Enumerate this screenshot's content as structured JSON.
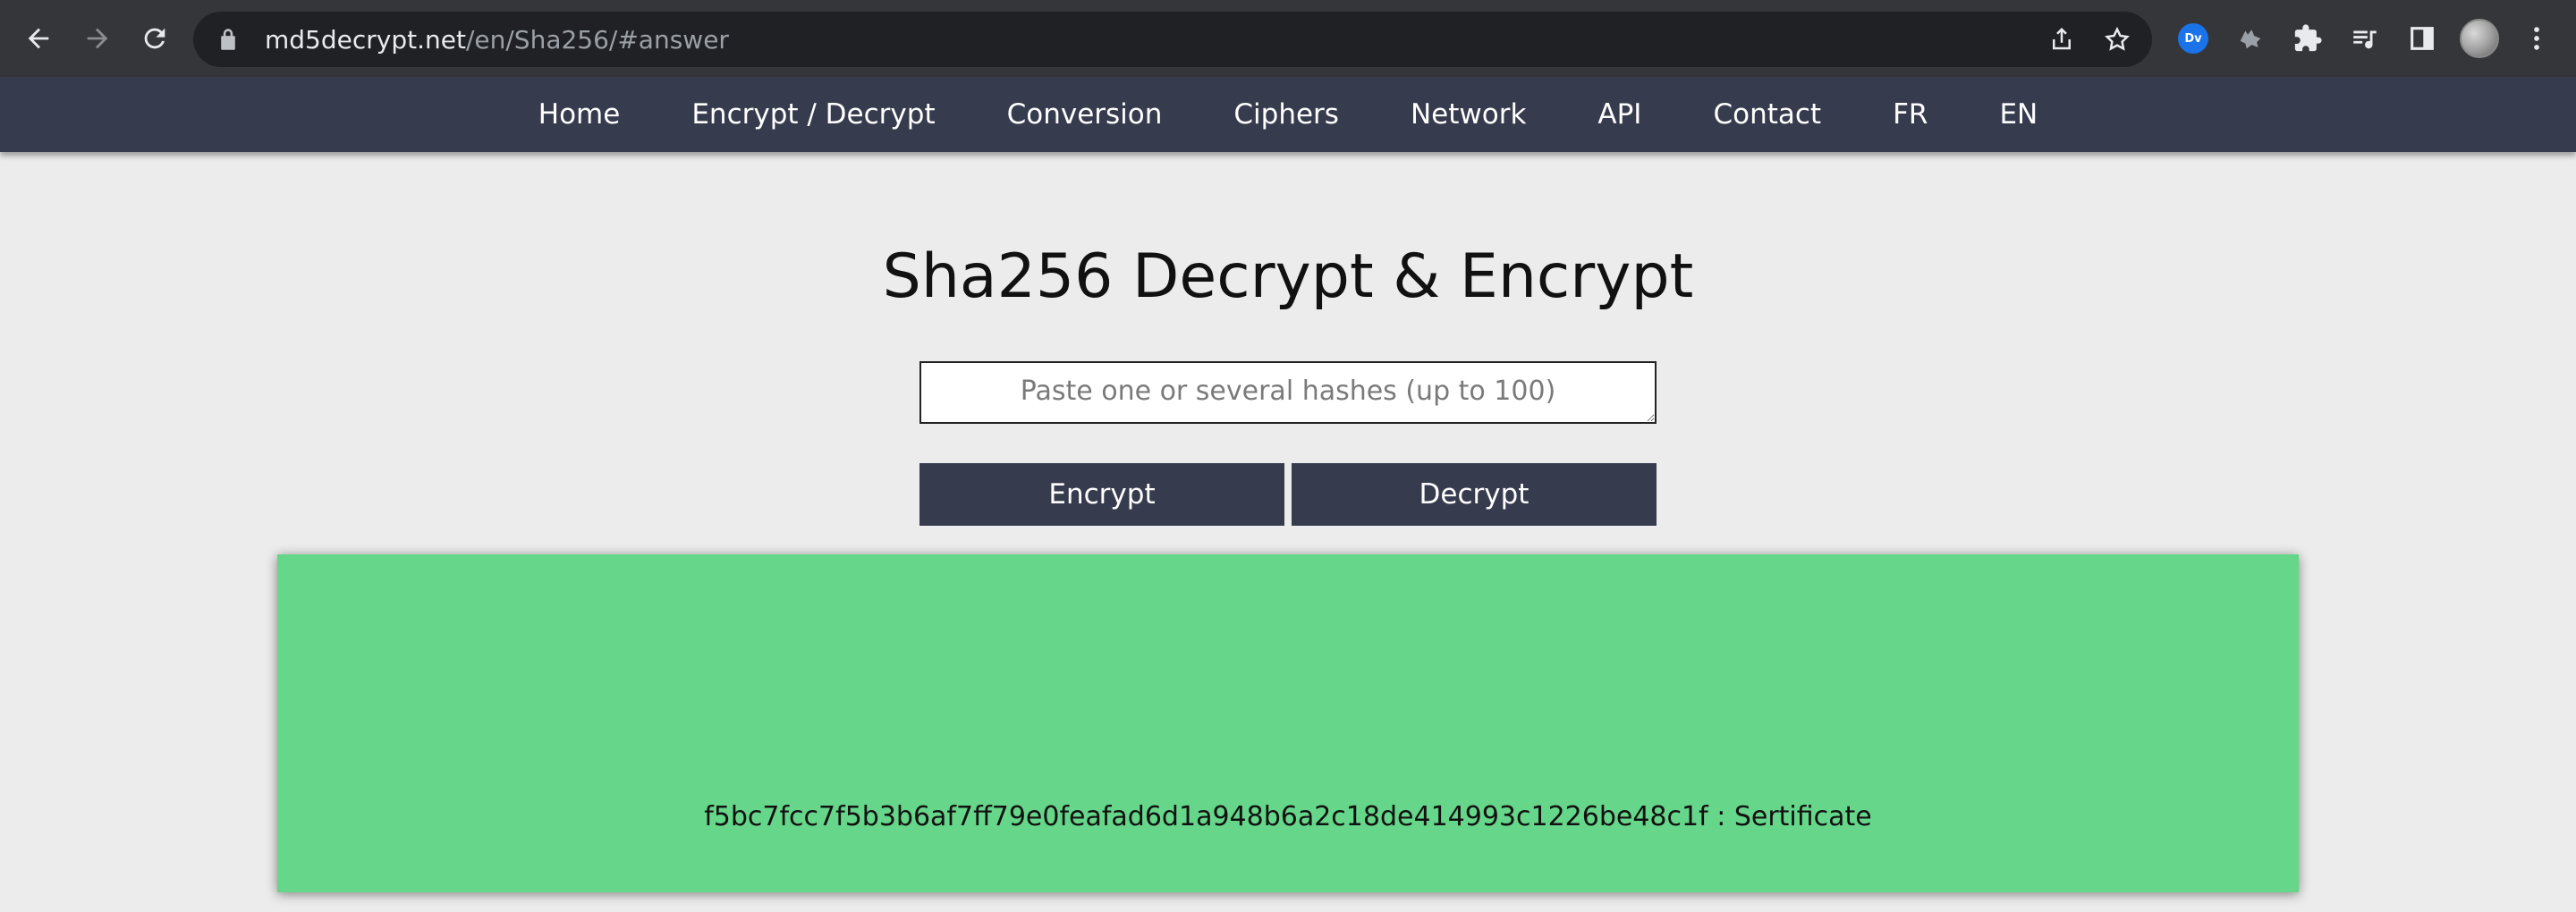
{
  "browser": {
    "url_domain": "md5decrypt.net",
    "url_path": "/en/Sha256/#answer",
    "extension_badge": "Dv"
  },
  "nav": {
    "items": [
      {
        "label": "Home"
      },
      {
        "label": "Encrypt / Decrypt"
      },
      {
        "label": "Conversion"
      },
      {
        "label": "Ciphers"
      },
      {
        "label": "Network"
      },
      {
        "label": "API"
      },
      {
        "label": "Contact"
      },
      {
        "label": "FR"
      },
      {
        "label": "EN"
      }
    ]
  },
  "main": {
    "title": "Sha256 Decrypt & Encrypt",
    "input_placeholder": "Paste one or several hashes (up to 100)",
    "input_value": "",
    "encrypt_label": "Encrypt",
    "decrypt_label": "Decrypt"
  },
  "answer": {
    "text": "f5bc7fcc7f5b3b6af7ff79e0feafad6d1a948b6a2c18de414993c1226be48c1f : Sertificate",
    "background": "#66d78a"
  },
  "colors": {
    "nav_bg": "#363b4e",
    "page_bg": "#ececec",
    "answer_bg": "#66d78a"
  }
}
